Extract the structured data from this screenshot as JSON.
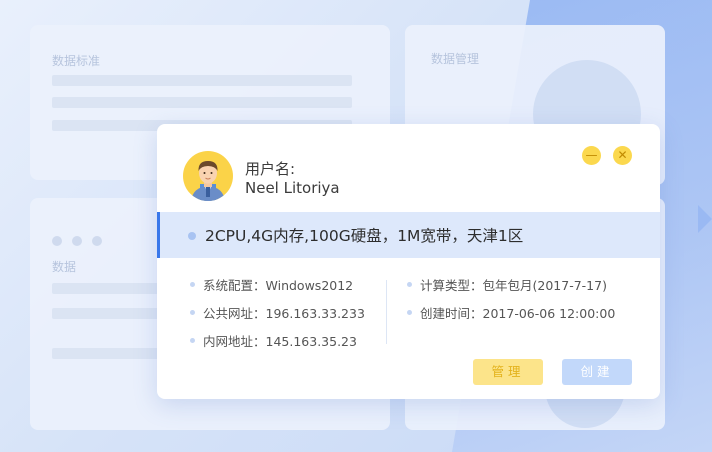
{
  "background": {
    "panel_left_title": "数据标准",
    "panel_right_title": "数据管理",
    "panel_lower_title": "数据"
  },
  "dialog": {
    "user_label": "用户名:",
    "user_name": "Neel Litoriya",
    "minimize_glyph": "—",
    "close_glyph": "✕",
    "spec": "2CPU,4G内存,100G硬盘，1M宽带，天津1区",
    "info_left": [
      {
        "label": "系统配置：",
        "value": "Windows2012"
      },
      {
        "label": "公共网址：",
        "value": "196.163.33.233"
      },
      {
        "label": "内网地址：",
        "value": "145.163.35.23"
      }
    ],
    "info_right": [
      {
        "label": "计算类型：",
        "value": "包年包月(2017-7-17)"
      },
      {
        "label": "创建时间：",
        "value": "2017-06-06  12:00:00"
      }
    ],
    "manage_label": "管理",
    "create_label": "创建"
  },
  "colors": {
    "accent_blue": "#3a78ea",
    "accent_yellow": "#fbd84e",
    "spec_bar_bg": "#dde8fb"
  },
  "icons": [
    "user-avatar-icon",
    "minimize-icon",
    "close-icon"
  ]
}
